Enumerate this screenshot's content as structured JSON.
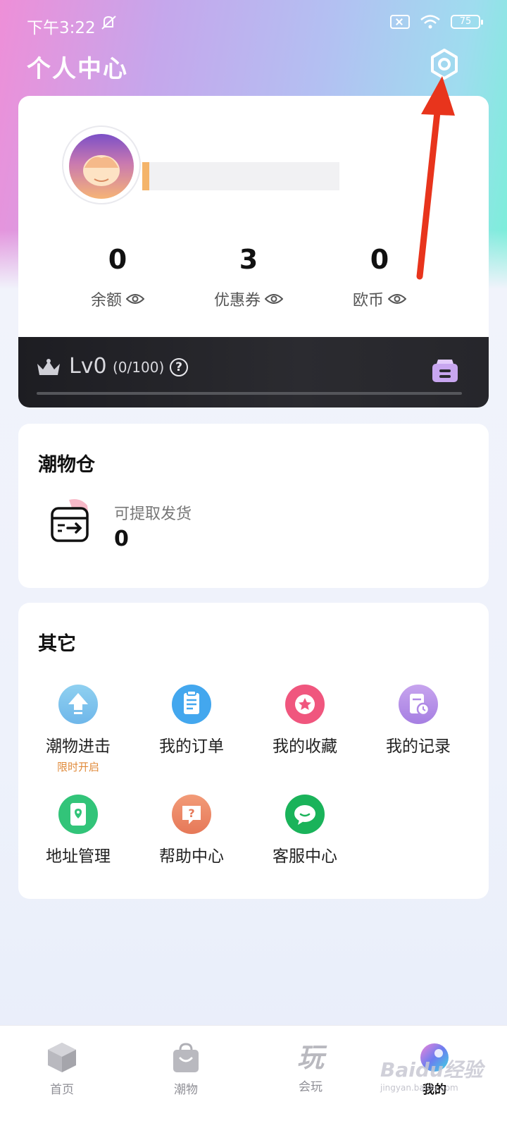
{
  "status_bar": {
    "time": "下午3:22",
    "battery": "75"
  },
  "header": {
    "title": "个人中心",
    "settings_icon": "gear-hexagon-icon"
  },
  "profile": {
    "stats": [
      {
        "value": "0",
        "label": "余额",
        "icon": "eye-icon"
      },
      {
        "value": "3",
        "label": "优惠券",
        "icon": "eye-icon"
      },
      {
        "value": "0",
        "label": "欧币",
        "icon": "eye-icon"
      }
    ]
  },
  "level": {
    "label": "Lv0",
    "progress": "(0/100)",
    "help": "?",
    "progress_fraction": 0
  },
  "warehouse": {
    "title": "潮物仓",
    "label": "可提取发货",
    "value": "0"
  },
  "others": {
    "title": "其它",
    "items": [
      {
        "label": "潮物进击",
        "sub": "限时开启",
        "icon": "upgrade-arrow-icon",
        "color": "#7fc3ec"
      },
      {
        "label": "我的订单",
        "icon": "order-list-icon",
        "color": "#43a7ee"
      },
      {
        "label": "我的收藏",
        "icon": "star-icon",
        "color": "#f0567e"
      },
      {
        "label": "我的记录",
        "icon": "record-clock-icon",
        "color": "#b68ee8"
      },
      {
        "label": "地址管理",
        "icon": "location-book-icon",
        "color": "#32c479"
      },
      {
        "label": "帮助中心",
        "icon": "question-bubble-icon",
        "color": "#ef8a6a"
      },
      {
        "label": "客服中心",
        "icon": "chat-bubble-icon",
        "color": "#1ab35a"
      }
    ]
  },
  "tabbar": {
    "tabs": [
      {
        "label": "首页",
        "icon": "home-cube-icon"
      },
      {
        "label": "潮物",
        "icon": "shopping-bag-icon"
      },
      {
        "label": "会玩",
        "icon": "play-text-icon",
        "glyph": "玩"
      },
      {
        "label": "我的",
        "icon": "profile-orb-icon",
        "active": true
      }
    ]
  },
  "watermark": {
    "text": "Baidu经验",
    "sub": "jingyan.baidu.com"
  }
}
